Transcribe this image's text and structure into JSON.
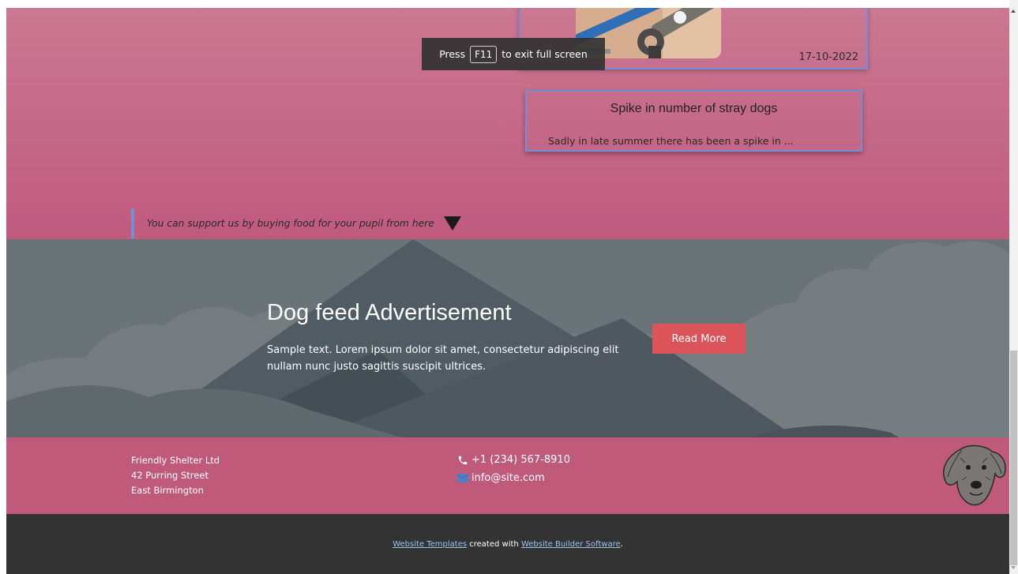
{
  "news": {
    "card_top": {
      "date": "17-10-2022"
    },
    "card2": {
      "title": "Spike in number of stray dogs",
      "excerpt": "Sadly in late summer there has been a spike in ..."
    },
    "support_text": "You can support us by buying food for your pupil from here"
  },
  "fullscreen_toast": {
    "press": "Press",
    "key": "F11",
    "rest": "to exit full screen"
  },
  "ad": {
    "title": "Dog feed Advertisement",
    "text": "Sample text. Lorem ipsum dolor sit amet, consectetur adipiscing elit nullam nunc justo sagittis suscipit ultrices.",
    "button": "Read More"
  },
  "contact": {
    "company": "Friendly Shelter Ltd",
    "street": "42 Purring Street",
    "city": "East Birmington",
    "phone": "+1 (234) 567-8910",
    "email": "info@site.com"
  },
  "footer": {
    "link1": "Website Templates",
    "middle": "created with",
    "link2": "Website Builder Software",
    "end": "."
  },
  "colors": {
    "pink": "#c05b7e",
    "card_border": "#6f8fd6",
    "button": "#db545a",
    "footer_bg": "#333333"
  }
}
